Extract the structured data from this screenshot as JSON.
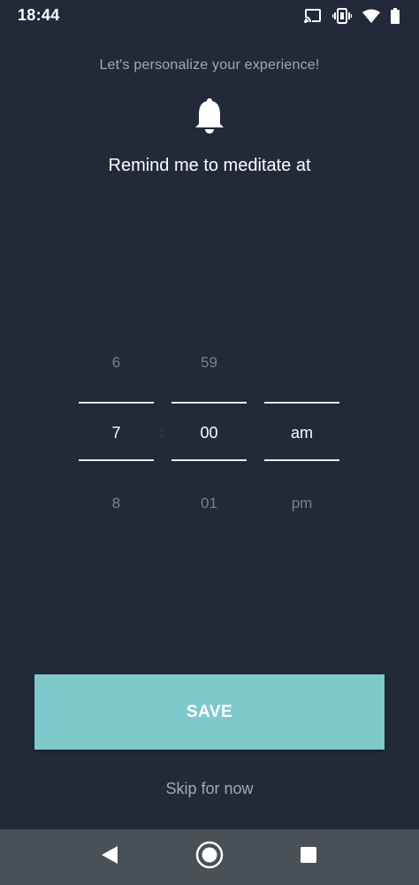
{
  "status_bar": {
    "time": "18:44",
    "icons": [
      "cast-icon",
      "vibrate-icon",
      "wifi-icon",
      "battery-icon"
    ]
  },
  "header": {
    "subtitle": "Let's personalize your experience!",
    "icon": "bell-icon",
    "title": "Remind me to meditate at"
  },
  "time_picker": {
    "hour": {
      "prev": "6",
      "selected": "7",
      "next": "8"
    },
    "separator": ":",
    "minute": {
      "prev": "59",
      "selected": "00",
      "next": "01"
    },
    "period": {
      "prev": "",
      "selected": "am",
      "next": "pm"
    }
  },
  "actions": {
    "save_label": "SAVE",
    "skip_label": "Skip for now"
  },
  "nav_bar": {
    "icons": [
      "back-icon",
      "home-icon",
      "recents-icon"
    ]
  },
  "colors": {
    "background": "#222938",
    "accent": "#7fc8cc",
    "muted_text": "#a2a9b6",
    "nav_bar": "#495056"
  }
}
